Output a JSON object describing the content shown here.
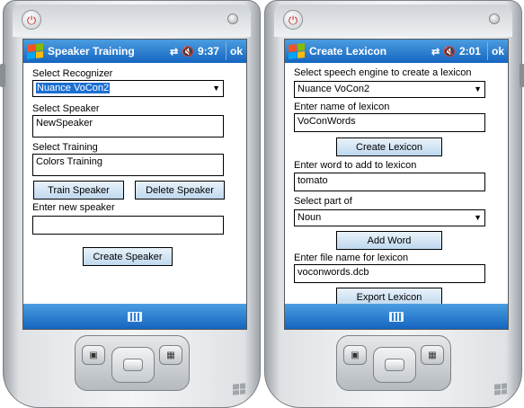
{
  "left_device": {
    "title": "Speaker Training",
    "clock": "9:37",
    "ok": "ok",
    "recognizer_label": "Select Recognizer",
    "recognizer_value": "Nuance VoCon2",
    "speaker_label": "Select Speaker",
    "speaker_value": "NewSpeaker",
    "training_label": "Select Training",
    "training_value": "Colors Training",
    "train_button": "Train Speaker",
    "delete_button": "Delete Speaker",
    "new_speaker_label": "Enter new speaker",
    "new_speaker_value": "",
    "create_button": "Create Speaker"
  },
  "right_device": {
    "title": "Create Lexicon",
    "clock": "2:01",
    "ok": "ok",
    "engine_label": "Select speech engine to create a lexicon",
    "engine_value": "Nuance VoCon2",
    "lexicon_name_label": "Enter name of lexicon",
    "lexicon_name_value": "VoConWords",
    "create_lexicon_button": "Create Lexicon",
    "word_label": "Enter word to add to lexicon",
    "word_value": "tomato",
    "part_label": "Select part of",
    "part_value": "Noun",
    "add_word_button": "Add Word",
    "file_label": "Enter file name for lexicon",
    "file_value": "voconwords.dcb",
    "export_button": "Export Lexicon"
  },
  "status_icons": {
    "connectivity": "⇄",
    "volume": "🔇"
  },
  "colors": {
    "titlebar": "#1565c0",
    "button": "#bfd8ee",
    "selection": "#1c6fd1"
  }
}
